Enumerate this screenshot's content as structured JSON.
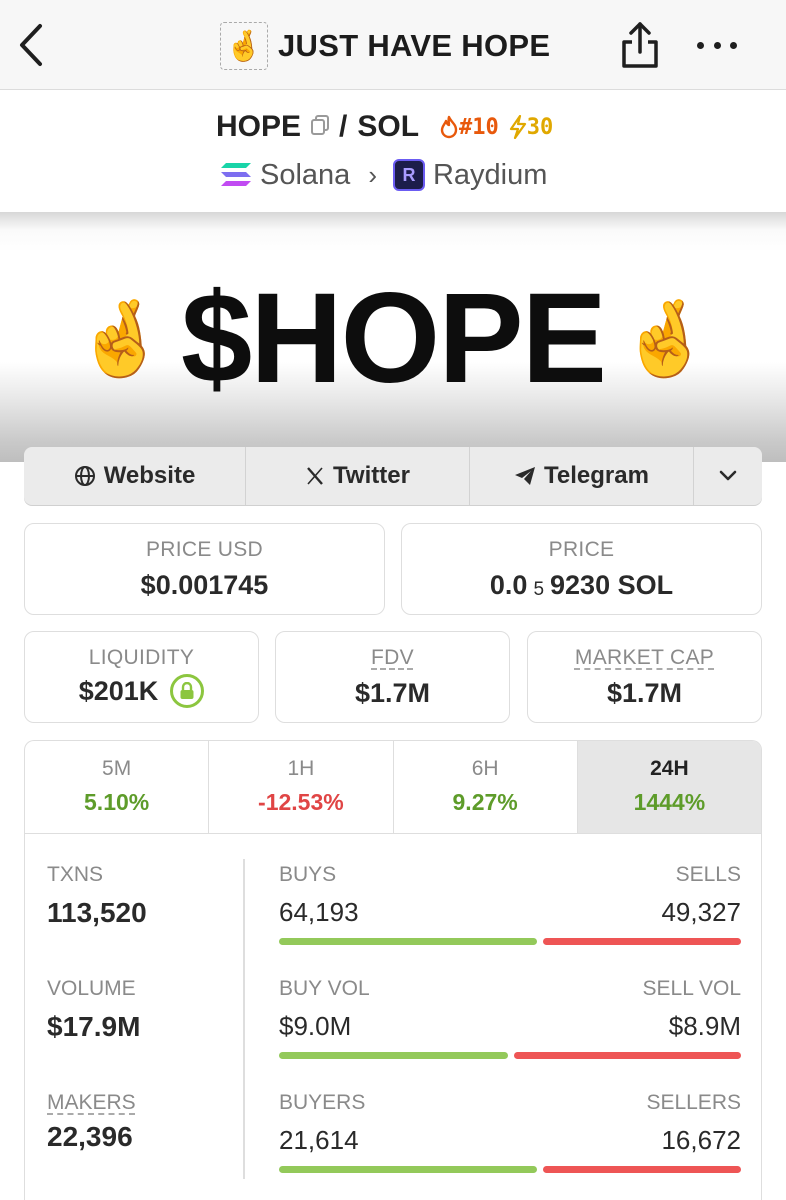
{
  "topbar": {
    "title": "JUST HAVE HOPE",
    "title_emoji": "🤞",
    "icons": {
      "back": "chevron-left-icon",
      "share": "share-icon",
      "more": "more-icon"
    }
  },
  "pair": {
    "base": "HOPE",
    "sep": "/",
    "quote": "SOL",
    "rank": "#10",
    "boost": "30",
    "chain": "Solana",
    "dex": "Raydium"
  },
  "banner": {
    "emoji": "🤞",
    "text": "$HOPE"
  },
  "links": {
    "website": "Website",
    "twitter": "Twitter",
    "telegram": "Telegram"
  },
  "stats": {
    "price_usd": {
      "label": "PRICE USD",
      "value": "$0.001745"
    },
    "price_native": {
      "label": "PRICE",
      "prefix": "0.0",
      "sub": "5",
      "suffix": "9230 SOL"
    },
    "liquidity": {
      "label": "LIQUIDITY",
      "value": "$201K"
    },
    "fdv": {
      "label": "FDV",
      "value": "$1.7M"
    },
    "market_cap": {
      "label": "MARKET CAP",
      "value": "$1.7M"
    }
  },
  "timeframes": [
    {
      "label": "5M",
      "value": "5.10%"
    },
    {
      "label": "1H",
      "value": "-12.53%"
    },
    {
      "label": "6H",
      "value": "9.27%"
    },
    {
      "label": "24H",
      "value": "1444%"
    }
  ],
  "activity": {
    "txns": {
      "label": "TXNS",
      "value": "113,520"
    },
    "volume": {
      "label": "VOLUME",
      "value": "$17.9M"
    },
    "makers": {
      "label": "MAKERS",
      "value": "22,396"
    },
    "buys": {
      "left_label": "BUYS",
      "right_label": "SELLS",
      "left_value": "64,193",
      "right_value": "49,327",
      "buy_fraction": 0.565
    },
    "buy_vol": {
      "left_label": "BUY VOL",
      "right_label": "SELL VOL",
      "left_value": "$9.0M",
      "right_value": "$8.9M",
      "buy_fraction": 0.503
    },
    "buyers": {
      "left_label": "BUYERS",
      "right_label": "SELLERS",
      "left_value": "21,614",
      "right_value": "16,672",
      "buy_fraction": 0.565
    }
  },
  "colors": {
    "positive": "#5e9c2a",
    "negative": "#e04545",
    "buy_bar": "#93c95a",
    "sell_bar": "#ee5555"
  }
}
